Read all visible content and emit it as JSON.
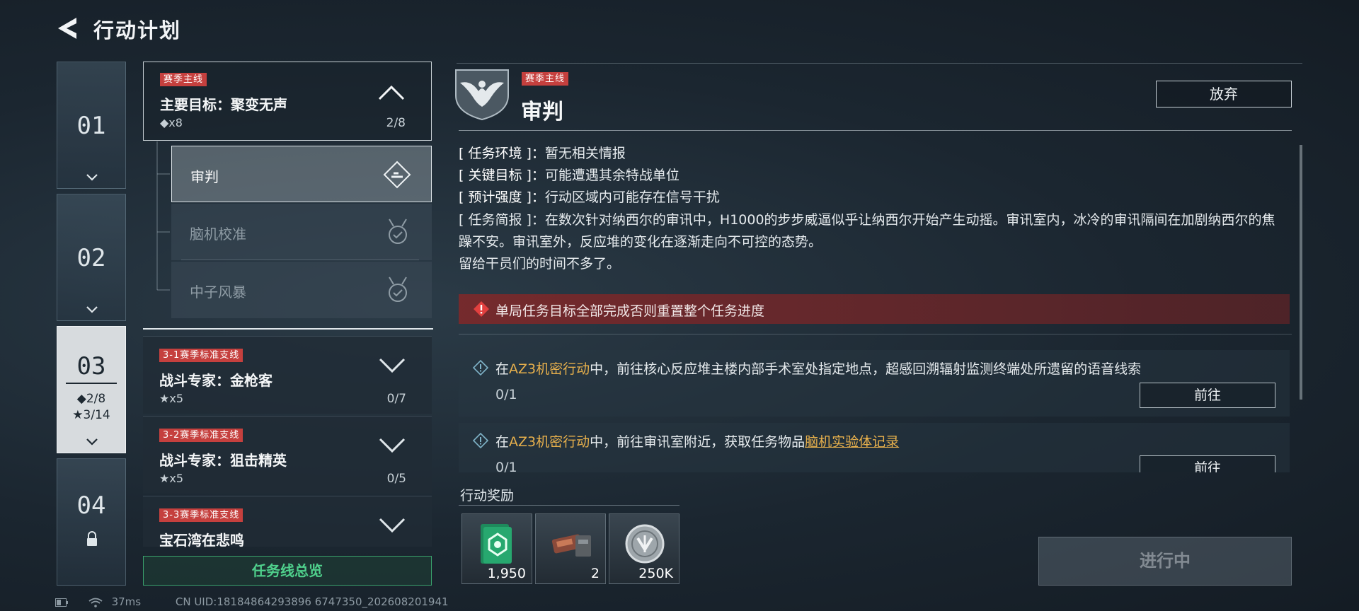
{
  "header": {
    "title": "行动计划"
  },
  "chapters": [
    {
      "number": "01"
    },
    {
      "number": "02"
    },
    {
      "number": "03",
      "stat_diamond": "◆2/8",
      "stat_star": "★3/14"
    },
    {
      "number": "04"
    }
  ],
  "mission_tree": {
    "main": {
      "tag": "赛季主线",
      "title": "主要目标：聚变无声",
      "sub": "◆x8",
      "progress": "2/8"
    },
    "sub_missions": [
      {
        "label": "审判"
      },
      {
        "label": "脑机校准"
      },
      {
        "label": "中子风暴"
      }
    ],
    "branches": [
      {
        "tag": "3-1赛季标准支线",
        "title": "战斗专家：金枪客",
        "sub": "★x5",
        "progress": "0/7"
      },
      {
        "tag": "3-2赛季标准支线",
        "title": "战斗专家：狙击精英",
        "sub": "★x5",
        "progress": "0/5"
      },
      {
        "tag": "3-3赛季标准支线",
        "title": "宝石湾在悲鸣"
      }
    ],
    "overview_button": "任务线总览"
  },
  "detail": {
    "tag": "赛季主线",
    "title": "审判",
    "abandon_button": "放弃",
    "env_key": "[ 任务环境 ]：",
    "env_val": "暂无相关情报",
    "target_key": "[ 关键目标 ]：",
    "target_val": "可能遭遇其余特战单位",
    "intensity_key": "[ 预计强度 ]：",
    "intensity_val": "行动区域内可能存在信号干扰",
    "brief_key": "[ 任务简报 ]：",
    "brief_val": "在数次针对纳西尔的审讯中，H1000的步步威逼似乎让纳西尔开始产生动摇。审讯室内，冰冷的审讯隔间在加剧纳西尔的焦躁不安。审讯室外，反应堆的变化在逐渐走向不可控的态势。",
    "brief_tail": "留给干员们的时间不多了。",
    "warning": "单局任务目标全部完成否则重置整个任务进度",
    "objectives": [
      {
        "pre": "在",
        "hl": "AZ3机密行动",
        "post": "中，前往核心反应堆主楼内部手术室处指定地点，超感回溯辐射监测终端处所遗留的语音线索",
        "count": "0/1",
        "go": "前往"
      },
      {
        "pre": "在",
        "hl": "AZ3机密行动",
        "mid": "中，前往审讯室附近，获取任务物品",
        "hl2": "脑机实验体记录",
        "count": "0/1",
        "go": "前往"
      }
    ]
  },
  "rewards": {
    "label": "行动奖励",
    "items": [
      {
        "icon": "exp-card-icon",
        "qty": "1,950"
      },
      {
        "icon": "weapon-parts-icon",
        "qty": "2"
      },
      {
        "icon": "coin-icon",
        "qty": "250K"
      }
    ]
  },
  "progress_button": "进行中",
  "status_bar": {
    "ping": "37ms",
    "uid": "CN UID:18184864293896 6747350_202608201941"
  },
  "colors": {
    "accent_green": "#4fd08c",
    "tag_red": "#c5403e",
    "highlight_gold": "#e7b04c",
    "warning_bg": "#7d282a"
  }
}
